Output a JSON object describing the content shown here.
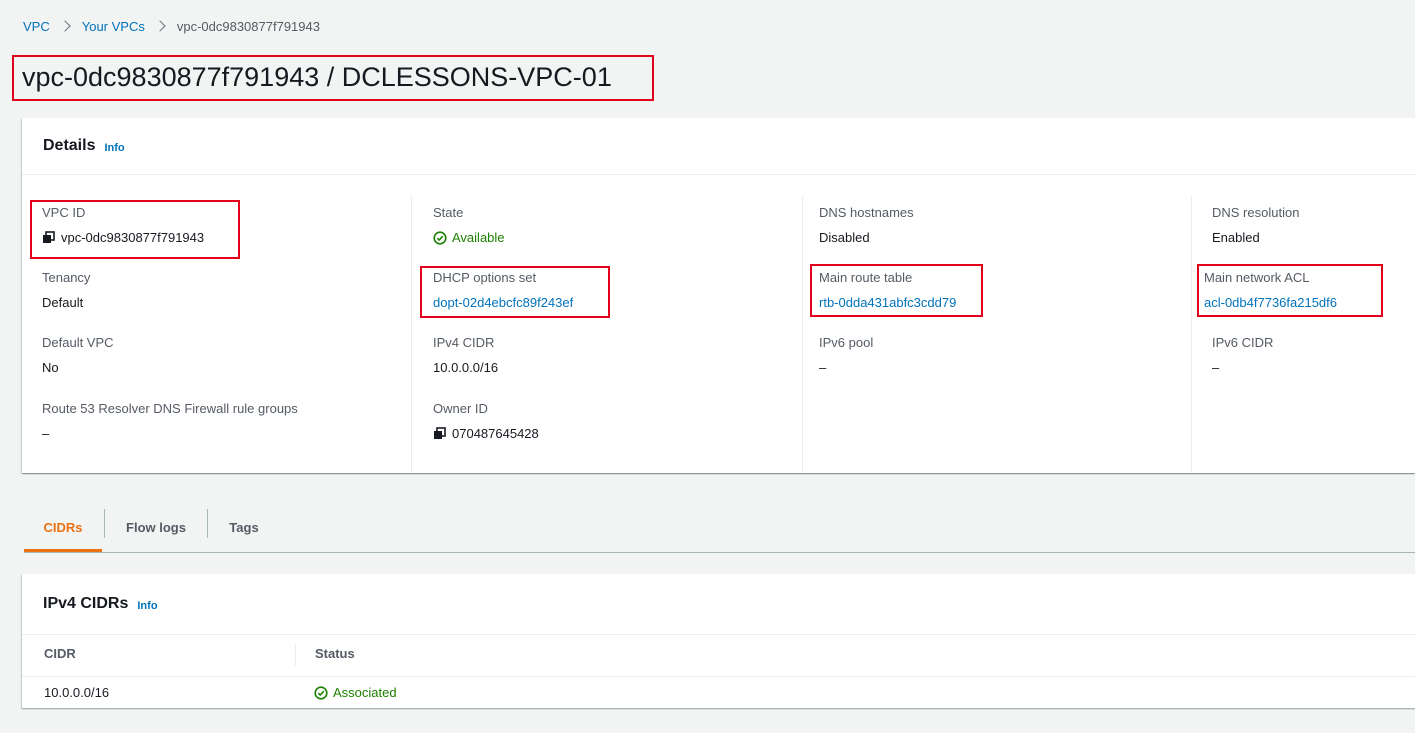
{
  "breadcrumb": {
    "root": "VPC",
    "parent": "Your VPCs",
    "current": "vpc-0dc9830877f791943"
  },
  "page_title": "vpc-0dc9830877f791943 / DCLESSONS-VPC-01",
  "details": {
    "title": "Details",
    "info": "Info",
    "fields": {
      "vpc_id": {
        "label": "VPC ID",
        "value": "vpc-0dc9830877f791943"
      },
      "tenancy": {
        "label": "Tenancy",
        "value": "Default"
      },
      "default_vpc": {
        "label": "Default VPC",
        "value": "No"
      },
      "route53": {
        "label": "Route 53 Resolver DNS Firewall rule groups",
        "value": "–"
      },
      "state": {
        "label": "State",
        "value": "Available"
      },
      "dhcp": {
        "label": "DHCP options set",
        "value": "dopt-02d4ebcfc89f243ef"
      },
      "ipv4_cidr": {
        "label": "IPv4 CIDR",
        "value": "10.0.0.0/16"
      },
      "owner_id": {
        "label": "Owner ID",
        "value": "070487645428"
      },
      "dns_hostnames": {
        "label": "DNS hostnames",
        "value": "Disabled"
      },
      "main_route_table": {
        "label": "Main route table",
        "value": "rtb-0dda431abfc3cdd79"
      },
      "ipv6_pool": {
        "label": "IPv6 pool",
        "value": "–"
      },
      "dns_resolution": {
        "label": "DNS resolution",
        "value": "Enabled"
      },
      "main_network_acl": {
        "label": "Main network ACL",
        "value": "acl-0db4f7736fa215df6"
      },
      "ipv6_cidr": {
        "label": "IPv6 CIDR",
        "value": "–"
      }
    }
  },
  "tabs": [
    {
      "label": "CIDRs",
      "active": true
    },
    {
      "label": "Flow logs",
      "active": false
    },
    {
      "label": "Tags",
      "active": false
    }
  ],
  "ipv4_cidrs": {
    "title": "IPv4 CIDRs",
    "info": "Info",
    "columns": [
      "CIDR",
      "Status"
    ],
    "rows": [
      {
        "cidr": "10.0.0.0/16",
        "status": "Associated"
      }
    ]
  },
  "colors": {
    "link": "#0073bb",
    "success": "#1d8102",
    "active_tab": "#ec7211",
    "highlight": "#e3001b"
  },
  "icons": {
    "copy": "copy-icon",
    "status": "check-circle-icon"
  }
}
